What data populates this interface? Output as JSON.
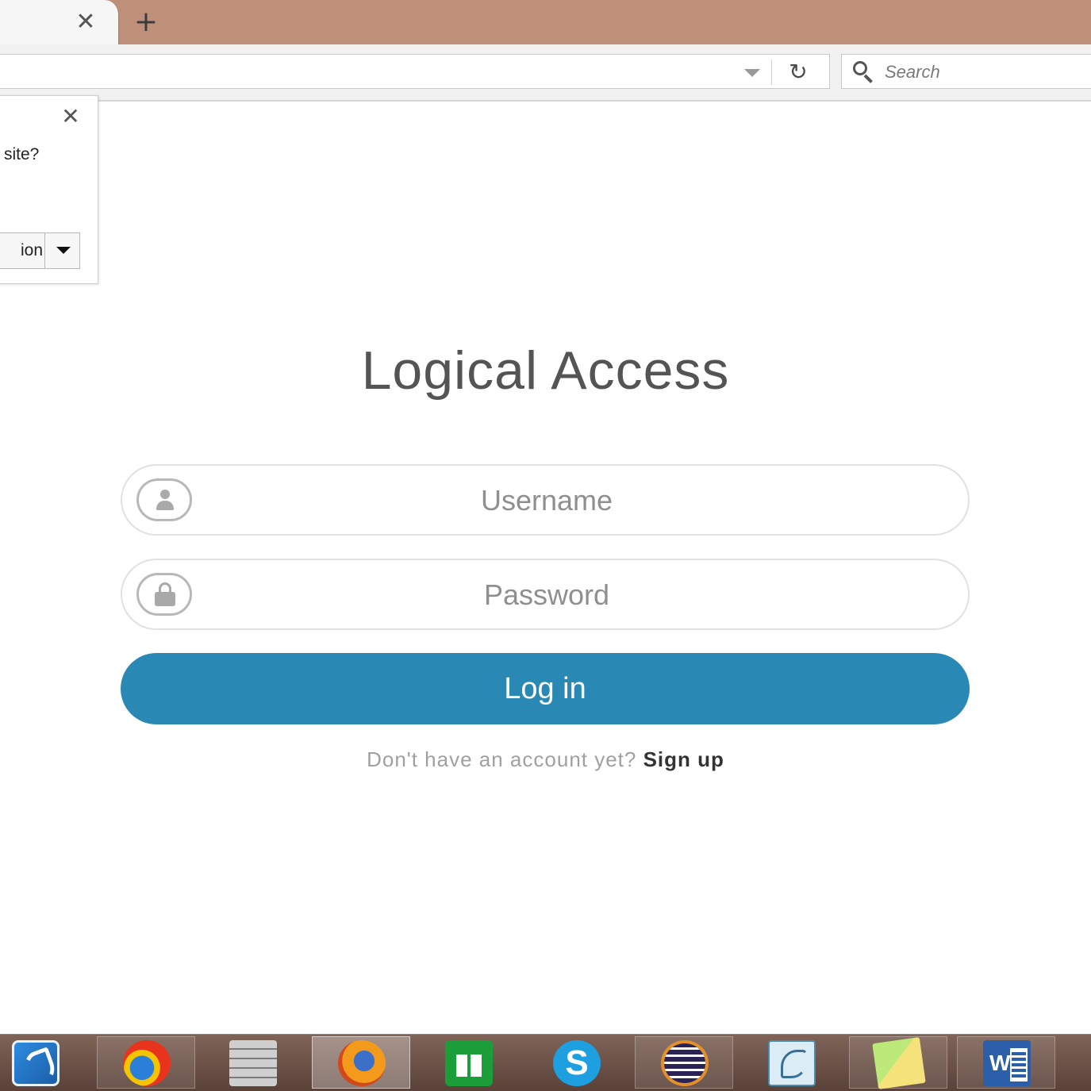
{
  "browser": {
    "tab_close_glyph": "✕",
    "new_tab_glyph": "+",
    "reload_glyph": "↻",
    "search": {
      "placeholder": "Search"
    }
  },
  "popup": {
    "close_glyph": "✕",
    "text": "site?",
    "button_label": "ion"
  },
  "login": {
    "title": "Logical Access",
    "username_placeholder": "Username",
    "password_placeholder": "Password",
    "login_label": "Log in",
    "signup_prompt": "Don't have an account yet?",
    "signup_link": "Sign up",
    "accent_color": "#2a89b4"
  },
  "taskbar": {
    "items": [
      {
        "icon": "document-app-icon"
      },
      {
        "icon": "swirl-app-icon"
      },
      {
        "icon": "firewall-icon"
      },
      {
        "icon": "firefox-icon",
        "active": true
      },
      {
        "icon": "windows-store-icon"
      },
      {
        "icon": "skype-icon",
        "glyph": "S"
      },
      {
        "icon": "eclipse-icon"
      },
      {
        "icon": "mysql-workbench-icon"
      },
      {
        "icon": "sticky-notes-icon"
      },
      {
        "icon": "word-icon",
        "glyph": "W"
      }
    ]
  }
}
